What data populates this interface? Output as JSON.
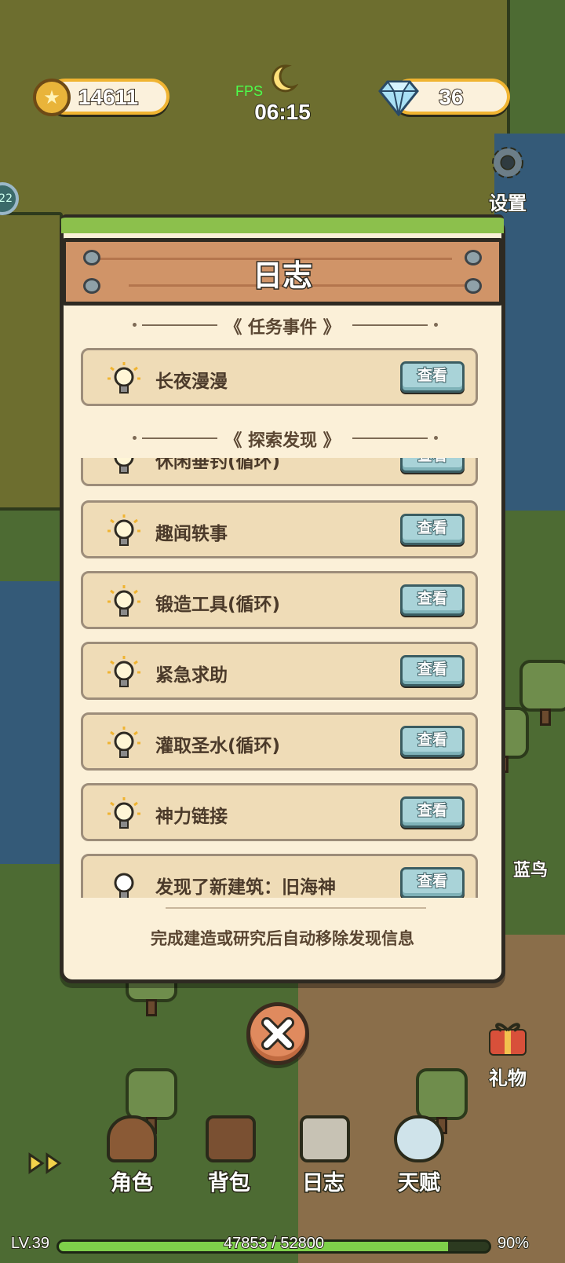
{
  "hud": {
    "coins": "14611",
    "gems": "36",
    "fps_label": "FPS",
    "clock": "06:15",
    "side_badge": "22"
  },
  "side": {
    "settings_label": "设置",
    "gift_label": "礼物",
    "npc_name": "蓝鸟"
  },
  "dialog": {
    "title": "日志",
    "section_quests": "任务事件",
    "section_discover": "探索发现",
    "quest_items": [
      {
        "label": "长夜漫漫",
        "button": "查看"
      }
    ],
    "discover_items": [
      {
        "label": "休闲垂钓(循环)",
        "button": "查看"
      },
      {
        "label": "趣闻轶事",
        "button": "查看"
      },
      {
        "label": "锻造工具(循环)",
        "button": "查看"
      },
      {
        "label": "紧急求助",
        "button": "查看"
      },
      {
        "label": "灌取圣水(循环)",
        "button": "查看"
      },
      {
        "label": "神力链接",
        "button": "查看"
      },
      {
        "label": "发现了新建筑：旧海神",
        "button": "查看"
      }
    ],
    "footer": "完成建造或研究后自动移除发现信息"
  },
  "nav": {
    "role": "角色",
    "bag": "背包",
    "log": "日志",
    "talent": "天赋"
  },
  "level": {
    "lv": "LV.39",
    "xp": "47853 / 52800",
    "percent": "90%",
    "progress": 0.906
  },
  "colors": {
    "panel": "#fbf0d8",
    "row": "#efdcb7",
    "button": "#a9d3d8",
    "plank": "#d09468",
    "xp": "#7ed04a"
  }
}
